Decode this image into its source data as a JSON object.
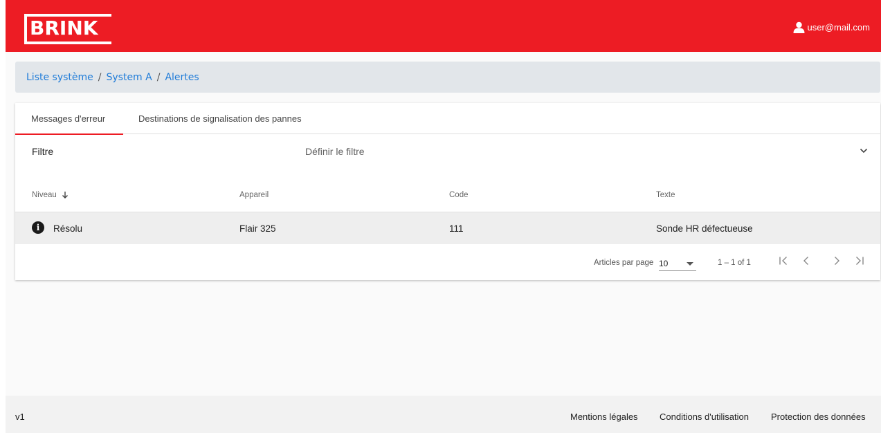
{
  "header": {
    "logo": "BRINK",
    "user_email": "user@mail.com"
  },
  "breadcrumb": {
    "items": [
      "Liste système",
      "System A",
      "Alertes"
    ],
    "separator": "/"
  },
  "tabs": [
    {
      "label": "Messages d'erreur",
      "active": true
    },
    {
      "label": "Destinations de signalisation des pannes",
      "active": false
    }
  ],
  "filter": {
    "label": "Filtre",
    "value": "Définir le filtre"
  },
  "table": {
    "columns": [
      "Niveau",
      "Appareil",
      "Code",
      "Texte"
    ],
    "sorted_column": "Niveau",
    "rows": [
      {
        "niveau": "Résolu",
        "appareil": "Flair 325",
        "code": "111",
        "texte": "Sonde HR défectueuse"
      }
    ]
  },
  "paginator": {
    "label": "Articles par page",
    "page_size": "10",
    "range": "1 – 1 of 1"
  },
  "footer": {
    "version": "v1",
    "links": [
      "Mentions légales",
      "Conditions d'utilisation",
      "Protection des données"
    ]
  },
  "colors": {
    "brand": "#ed1c24",
    "link": "#1e7bd8"
  }
}
